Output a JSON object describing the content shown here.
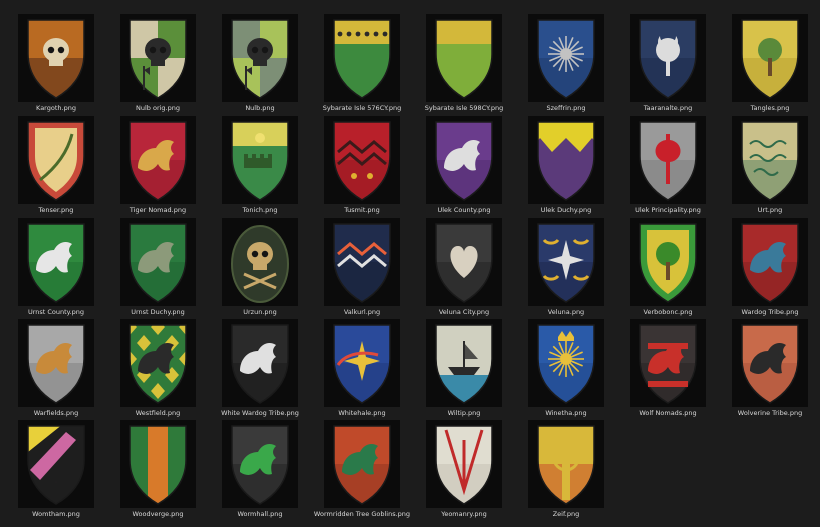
{
  "files": [
    {
      "label": "Kargoth.png",
      "colors": [
        "#b96a22",
        "#402018"
      ],
      "icon": "skull-icon",
      "pattern": "full",
      "iconColor": "#e0d2b0"
    },
    {
      "label": "Nulb orig.png",
      "colors": [
        "#cfc7a6",
        "#5b8f3a"
      ],
      "icon": "skull-axe-icon",
      "pattern": "quarter",
      "iconColor": "#2a2a2a"
    },
    {
      "label": "Nulb.png",
      "colors": [
        "#7d8f76",
        "#a8c25a"
      ],
      "icon": "skull-axe-icon",
      "pattern": "quarter",
      "iconColor": "#2a2a2a"
    },
    {
      "label": "Sybarate Isle 576CY.png",
      "colors": [
        "#d3b83a",
        "#3d8a3e"
      ],
      "icon": "spade-row-icon",
      "pattern": "chief",
      "iconColor": "#2a2a2a"
    },
    {
      "label": "Sybarate Isle 598CY.png",
      "colors": [
        "#d3b83a",
        "#7fae3a"
      ],
      "icon": "crown-icon",
      "pattern": "chief",
      "iconColor": "#d3b83a"
    },
    {
      "label": "Szeffrin.png",
      "colors": [
        "#2a4f8d",
        "#1d3766"
      ],
      "icon": "sun-icon",
      "pattern": "full",
      "iconColor": "#c2c2c2"
    },
    {
      "label": "Taaranalte.png",
      "colors": [
        "#2b3d63",
        "#1a2947"
      ],
      "icon": "crescent-tree-icon",
      "pattern": "full",
      "iconColor": "#dcdcdc"
    },
    {
      "label": "Tangles.png",
      "colors": [
        "#d8c24a",
        "#b39b2d"
      ],
      "icon": "tree-icon",
      "pattern": "full",
      "iconColor": "#5a8a3a"
    },
    {
      "label": "Tenser.png",
      "colors": [
        "#c84a3a",
        "#e8cf8a"
      ],
      "icon": "scimitar-icon",
      "pattern": "bordure",
      "iconColor": "#4b6b2a"
    },
    {
      "label": "Tiger Nomad.png",
      "colors": [
        "#b8263a",
        "#8e1a2a"
      ],
      "icon": "tiger-icon",
      "pattern": "full",
      "iconColor": "#d9a84a"
    },
    {
      "label": "Tonich.png",
      "colors": [
        "#d8d05a",
        "#3a8a48"
      ],
      "icon": "castle-icon",
      "pattern": "chief",
      "iconColor": "#2f5a2a"
    },
    {
      "label": "Tusmit.png",
      "colors": [
        "#b8202a",
        "#8e1820"
      ],
      "icon": "chevron-stars-icon",
      "pattern": "full",
      "iconColor": "#e0b030"
    },
    {
      "label": "Ulek County.png",
      "colors": [
        "#6a3c8c",
        "#4e2a6a"
      ],
      "icon": "lion-icon",
      "pattern": "full",
      "iconColor": "#dedede"
    },
    {
      "label": "Ulek Duchy.png",
      "colors": [
        "#e2cf2a",
        "#5b3a7a"
      ],
      "icon": "dancetty-icon",
      "pattern": "dancetty",
      "iconColor": "#5b3a7a"
    },
    {
      "label": "Ulek Principality.png",
      "colors": [
        "#9a9a9a",
        "#7a7a7a"
      ],
      "icon": "axe-icon",
      "pattern": "full",
      "iconColor": "#c8202a"
    },
    {
      "label": "Urt.png",
      "colors": [
        "#c9c08a",
        "#4a7a5a"
      ],
      "icon": "script-icon",
      "pattern": "full",
      "iconColor": "#2f6a4a"
    },
    {
      "label": "Urnst County.png",
      "colors": [
        "#2f8a3e",
        "#1f6a2e"
      ],
      "icon": "swan-icon",
      "pattern": "full",
      "iconColor": "#e6e6e6"
    },
    {
      "label": "Urnst Duchy.png",
      "colors": [
        "#2a7a3e",
        "#1d5f2e"
      ],
      "icon": "griffon-icon",
      "pattern": "full",
      "iconColor": "#8c9a7a"
    },
    {
      "label": "Urzun.png",
      "colors": [
        "#2f3a2a",
        "#1e261c"
      ],
      "icon": "skull-crossbones-icon",
      "pattern": "oval",
      "iconColor": "#c8a86a"
    },
    {
      "label": "Valkurl.png",
      "colors": [
        "#202c4c",
        "#172036"
      ],
      "icon": "wave-flame-icon",
      "pattern": "full",
      "iconColor": "#e8603a"
    },
    {
      "label": "Veluna City.png",
      "colors": [
        "#3a3a3a",
        "#222222"
      ],
      "icon": "heart-icon",
      "pattern": "full",
      "iconColor": "#d8d0c0"
    },
    {
      "label": "Veluna.png",
      "colors": [
        "#2a3a6a",
        "#1a2648"
      ],
      "icon": "star-moons-icon",
      "pattern": "full",
      "iconColor": "#e0e0e0"
    },
    {
      "label": "Verbobonc.png",
      "colors": [
        "#3a9a3a",
        "#d8c23a"
      ],
      "icon": "tree-bordure-icon",
      "pattern": "bordure",
      "iconColor": "#3a8a2a"
    },
    {
      "label": "Wardog Tribe.png",
      "colors": [
        "#a82a2a",
        "#7e1e1e"
      ],
      "icon": "wolf-icon",
      "pattern": "full",
      "iconColor": "#3a7a9a"
    },
    {
      "label": "Warfields.png",
      "colors": [
        "#a8a8a8",
        "#7a7a7a"
      ],
      "icon": "hound-icon",
      "pattern": "full",
      "iconColor": "#c88a3a"
    },
    {
      "label": "Westfield.png",
      "colors": [
        "#2f7a3a",
        "#d8c23a"
      ],
      "icon": "lion-harlequin-icon",
      "pattern": "lozengy",
      "iconColor": "#2a2a2a"
    },
    {
      "label": "White Wardog Tribe.png",
      "colors": [
        "#2a2a2a",
        "#161616"
      ],
      "icon": "wolf-icon",
      "pattern": "full",
      "iconColor": "#e0e0e0"
    },
    {
      "label": "Whitehale.png",
      "colors": [
        "#2a4a9a",
        "#1e3878"
      ],
      "icon": "comet-icon",
      "pattern": "full",
      "iconColor": "#e8c03a"
    },
    {
      "label": "Wiltip.png",
      "colors": [
        "#d0d0c0",
        "#3a8aa8"
      ],
      "icon": "ship-icon",
      "pattern": "base",
      "iconColor": "#2a2a2a"
    },
    {
      "label": "Winetha.png",
      "colors": [
        "#2a5aa8",
        "#1e4486"
      ],
      "icon": "sun-crown-icon",
      "pattern": "full",
      "iconColor": "#e8c03a"
    },
    {
      "label": "Wolf Nomads.png",
      "colors": [
        "#3a3434",
        "#262222"
      ],
      "icon": "wolves-icon",
      "pattern": "full",
      "iconColor": "#c8302a"
    },
    {
      "label": "Wolverine Tribe.png",
      "colors": [
        "#c86a4a",
        "#a8503a"
      ],
      "icon": "wolverine-icon",
      "pattern": "full",
      "iconColor": "#2a2a2a"
    },
    {
      "label": "Womtham.png",
      "colors": [
        "#e8d03a",
        "#1e1e1e"
      ],
      "icon": "bend-icon",
      "pattern": "bend",
      "iconColor": "#e070b0"
    },
    {
      "label": "Woodverge.png",
      "colors": [
        "#2f7a3a",
        "#d87a2a"
      ],
      "icon": "pale-icon",
      "pattern": "pale",
      "iconColor": "#d87a2a"
    },
    {
      "label": "Wormhall.png",
      "colors": [
        "#3a3a3a",
        "#222222"
      ],
      "icon": "dragon-icon",
      "pattern": "full",
      "iconColor": "#3aa84a"
    },
    {
      "label": "Wormridden Tree Goblins.png",
      "colors": [
        "#c04a2a",
        "#8a3220"
      ],
      "icon": "worm-icon",
      "pattern": "full",
      "iconColor": "#2a7a4a"
    },
    {
      "label": "Yeomanry.png",
      "colors": [
        "#e0ddd0",
        "#c0bdb0"
      ],
      "icon": "pile-icon",
      "pattern": "full",
      "iconColor": "#c02a2a"
    },
    {
      "label": "Zeif.png",
      "colors": [
        "#d8b83a",
        "#c83a2a"
      ],
      "icon": "cross-ring-icon",
      "pattern": "full",
      "iconColor": "#d8b83a"
    }
  ]
}
